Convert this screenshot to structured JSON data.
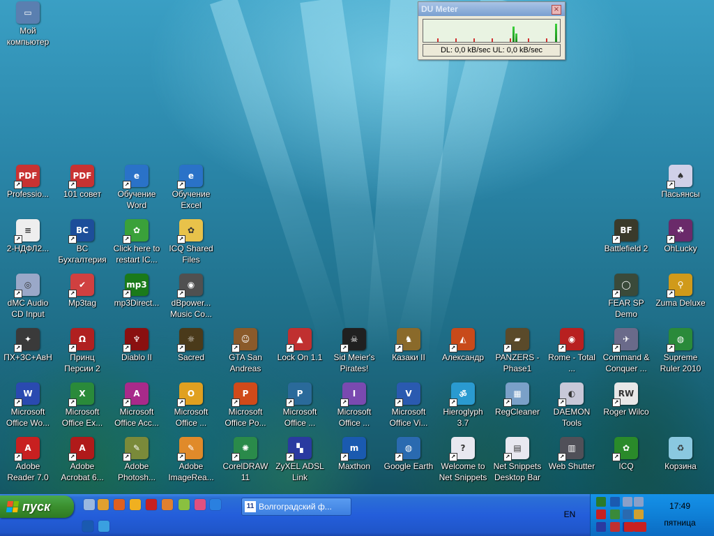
{
  "desktop": {
    "icons": [
      {
        "label": "Мой компьютер",
        "icon": "my-computer-icon",
        "color": "#5a7fb0",
        "glyph": "▭"
      },
      {
        "label": "Professio...",
        "icon": "pdf-icon",
        "color": "#c83232",
        "glyph": "PDF"
      },
      {
        "label": "101 совет",
        "icon": "pdf-icon",
        "color": "#c83232",
        "glyph": "PDF"
      },
      {
        "label": "Обучение Word",
        "icon": "internet-explorer-icon",
        "color": "#2a72c8",
        "glyph": "e"
      },
      {
        "label": "Обучение Excel",
        "icon": "internet-explorer-icon",
        "color": "#2a72c8",
        "glyph": "e"
      },
      {
        "label": "2-НДФЛ2...",
        "icon": "document-icon",
        "color": "#eeeeee",
        "glyph": "≡"
      },
      {
        "label": "BC Бухгалтерия",
        "icon": "bc-accounting-icon",
        "color": "#1d4e9a",
        "glyph": "BC"
      },
      {
        "label": "Click here to restart IC...",
        "icon": "icq-restart-icon",
        "color": "#3aa13a",
        "glyph": "✿"
      },
      {
        "label": "ICQ Shared Files",
        "icon": "folder-icon",
        "color": "#e8c24a",
        "glyph": "✿"
      },
      {
        "label": "dMC Audio CD Input",
        "icon": "cd-icon",
        "color": "#9aa8c8",
        "glyph": "◎"
      },
      {
        "label": "Mp3tag",
        "icon": "mp3tag-icon",
        "color": "#d04040",
        "glyph": "✔"
      },
      {
        "label": "mp3Direct...",
        "icon": "mp3directcut-icon",
        "color": "#1a7a1a",
        "glyph": "mp3"
      },
      {
        "label": "dBpower... Music Co...",
        "icon": "speaker-icon",
        "color": "#505050",
        "glyph": "◉"
      },
      {
        "label": "ПХ+ЗС+АвН",
        "icon": "heroes-game-icon",
        "color": "#3a3a3a",
        "glyph": "✦"
      },
      {
        "label": "Принц Персии 2",
        "icon": "prince-of-persia-icon",
        "color": "#b02020",
        "glyph": "Ω"
      },
      {
        "label": "Diablo II",
        "icon": "diablo-icon",
        "color": "#8a1010",
        "glyph": "♆"
      },
      {
        "label": "Sacred",
        "icon": "sacred-icon",
        "color": "#4a3a1a",
        "glyph": "☼"
      },
      {
        "label": "GTA San Andreas",
        "icon": "gta-icon",
        "color": "#8a5a2a",
        "glyph": "☺"
      },
      {
        "label": "Lock On 1.1",
        "icon": "lock-on-icon",
        "color": "#c03030",
        "glyph": "▲"
      },
      {
        "label": "Sid Meier's Pirates!",
        "icon": "pirates-icon",
        "color": "#202020",
        "glyph": "☠"
      },
      {
        "label": "Казаки II",
        "icon": "cossacks-icon",
        "color": "#8a6a2a",
        "glyph": "♞"
      },
      {
        "label": "Александр",
        "icon": "alexander-icon",
        "color": "#c84a1a",
        "glyph": "◭"
      },
      {
        "label": "PANZERS - Phase1",
        "icon": "panzers-icon",
        "color": "#5a4a2a",
        "glyph": "▰"
      },
      {
        "label": "Rome - Total ...",
        "icon": "rome-icon",
        "color": "#b82020",
        "glyph": "◉"
      },
      {
        "label": "Command & Conquer ...",
        "icon": "command-conquer-icon",
        "color": "#6a6a8a",
        "glyph": "✈"
      },
      {
        "label": "Supreme Ruler 2010",
        "icon": "globe-icon",
        "color": "#2a8a3a",
        "glyph": "◍"
      },
      {
        "label": "Пасьянсы",
        "icon": "solitaire-icon",
        "color": "#d0d0e8",
        "glyph": "♠"
      },
      {
        "label": "Battlefield 2",
        "icon": "battlefield-icon",
        "color": "#3a3a2a",
        "glyph": "BF"
      },
      {
        "label": "OhLucky",
        "icon": "ohlucky-icon",
        "color": "#6a2a6a",
        "glyph": "☘"
      },
      {
        "label": "FEAR SP Demo",
        "icon": "fear-icon",
        "color": "#3a4a3a",
        "glyph": "◯"
      },
      {
        "label": "Zuma Deluxe",
        "icon": "zuma-icon",
        "color": "#d09a1a",
        "glyph": "⚲"
      },
      {
        "label": "Microsoft Office Wo...",
        "icon": "word-icon",
        "color": "#2a4ab0",
        "glyph": "W"
      },
      {
        "label": "Microsoft Office Ex...",
        "icon": "excel-icon",
        "color": "#2a8a3a",
        "glyph": "X"
      },
      {
        "label": "Microsoft Office Acc...",
        "icon": "access-icon",
        "color": "#a82a8a",
        "glyph": "A"
      },
      {
        "label": "Microsoft Office ...",
        "icon": "outlook-icon",
        "color": "#e0a020",
        "glyph": "O"
      },
      {
        "label": "Microsoft Office Po...",
        "icon": "powerpoint-icon",
        "color": "#d04a1a",
        "glyph": "P"
      },
      {
        "label": "Microsoft Office ...",
        "icon": "publisher-icon",
        "color": "#2a6a9a",
        "glyph": "P"
      },
      {
        "label": "Microsoft Office ...",
        "icon": "infopath-icon",
        "color": "#7a4ab0",
        "glyph": "I"
      },
      {
        "label": "Microsoft Office Vi...",
        "icon": "visio-icon",
        "color": "#2a5ab0",
        "glyph": "V"
      },
      {
        "label": "Hieroglyph 3.7",
        "icon": "hieroglyph-icon",
        "color": "#2a9ad0",
        "glyph": "ॐ"
      },
      {
        "label": "RegCleaner",
        "icon": "regcleaner-icon",
        "color": "#7aa0c8",
        "glyph": "▦"
      },
      {
        "label": "DAEMON Tools",
        "icon": "daemon-tools-icon",
        "color": "#c8c8d8",
        "glyph": "◐"
      },
      {
        "label": "Roger Wilco",
        "icon": "roger-wilco-icon",
        "color": "#e8e8e8",
        "glyph": "RW"
      },
      {
        "label": "Adobe Reader 7.0",
        "icon": "adobe-reader-icon",
        "color": "#c82020",
        "glyph": "A"
      },
      {
        "label": "Adobe Acrobat 6...",
        "icon": "adobe-acrobat-icon",
        "color": "#b01a1a",
        "glyph": "A"
      },
      {
        "label": "Adobe Photosh...",
        "icon": "photoshop-icon",
        "color": "#7a8a3a",
        "glyph": "✎"
      },
      {
        "label": "Adobe ImageRea...",
        "icon": "imageready-icon",
        "color": "#e08a2a",
        "glyph": "✎"
      },
      {
        "label": "CorelDRAW 11",
        "icon": "coreldraw-icon",
        "color": "#2a8a4a",
        "glyph": "✺"
      },
      {
        "label": "ZyXEL ADSL Link",
        "icon": "zyxel-icon",
        "color": "#2a3aa0",
        "glyph": "▚"
      },
      {
        "label": "Maxthon",
        "icon": "maxthon-icon",
        "color": "#1a5ab0",
        "glyph": "m"
      },
      {
        "label": "Google Earth",
        "icon": "google-earth-icon",
        "color": "#2a6ab0",
        "glyph": "◍"
      },
      {
        "label": "Welcome to Net Snippets",
        "icon": "net-snippets-icon",
        "color": "#e8e8f0",
        "glyph": "?"
      },
      {
        "label": "Net Snippets Desktop Bar",
        "icon": "net-snippets-bar-icon",
        "color": "#e8e8f0",
        "glyph": "▤"
      },
      {
        "label": "Web Shutter",
        "icon": "web-shutter-icon",
        "color": "#505058",
        "glyph": "▥"
      },
      {
        "label": "ICQ",
        "icon": "icq-icon",
        "color": "#2a8a2a",
        "glyph": "✿"
      },
      {
        "label": "Корзина",
        "icon": "recycle-bin-icon",
        "color": "#8ac8e0",
        "glyph": "♻"
      }
    ]
  },
  "du_meter": {
    "title": "DU Meter",
    "stats": "DL: 0,0 kB/sec  UL: 0,0 kB/sec"
  },
  "taskbar": {
    "start_label": "пуск",
    "quick_launch": [
      {
        "icon": "show-desktop-icon",
        "color": "#9ab8e0"
      },
      {
        "icon": "pencil-icon",
        "color": "#e0a030"
      },
      {
        "icon": "media-player-icon",
        "color": "#e06020"
      },
      {
        "icon": "winamp-icon",
        "color": "#f0b020"
      },
      {
        "icon": "opera-icon",
        "color": "#c82020"
      },
      {
        "icon": "sunset-icon",
        "color": "#e08030"
      },
      {
        "icon": "paint-icon",
        "color": "#8ac040"
      },
      {
        "icon": "rainbow-icon",
        "color": "#e05080"
      },
      {
        "icon": "internet-explorer-icon",
        "color": "#2a80e0"
      },
      {
        "icon": "maxthon-icon",
        "color": "#1a5ab0"
      },
      {
        "icon": "globe-icon",
        "color": "#3aa0e0"
      }
    ],
    "task_button": {
      "icon_text": "11",
      "label": "Волгоградский ф..."
    },
    "language": "EN",
    "tray_icons": [
      {
        "icon": "tray-app-1-icon",
        "color": "#2a7a2a"
      },
      {
        "icon": "maxthon-tray-icon",
        "color": "#1a5ab0"
      },
      {
        "icon": "network-icon",
        "color": "#8aa0c8"
      },
      {
        "icon": "network-2-icon",
        "color": "#8aa0c8"
      },
      {
        "icon": "disconnected-icon",
        "color": "#c82020"
      },
      {
        "icon": "tray-app-2-icon",
        "color": "#3a8a3a"
      },
      {
        "icon": "tray-app-3-icon",
        "color": "#2a6ab0"
      },
      {
        "icon": "tray-app-4-icon",
        "color": "#d0a030"
      },
      {
        "icon": "tray-app-5-icon",
        "color": "#2a3aa0"
      },
      {
        "icon": "tray-app-6-icon",
        "color": "#c03030"
      },
      {
        "icon": "tray-app-7-icon",
        "color": "#1a3a9a"
      },
      {
        "icon": "kaspersky-icon",
        "color": "#c82020"
      },
      {
        "icon": "language-en-icon",
        "color": "#c82020"
      },
      {
        "icon": "up-down-arrow-icon",
        "color": "#c82020"
      }
    ],
    "clock_time": "17:49",
    "clock_day": "пятница"
  }
}
